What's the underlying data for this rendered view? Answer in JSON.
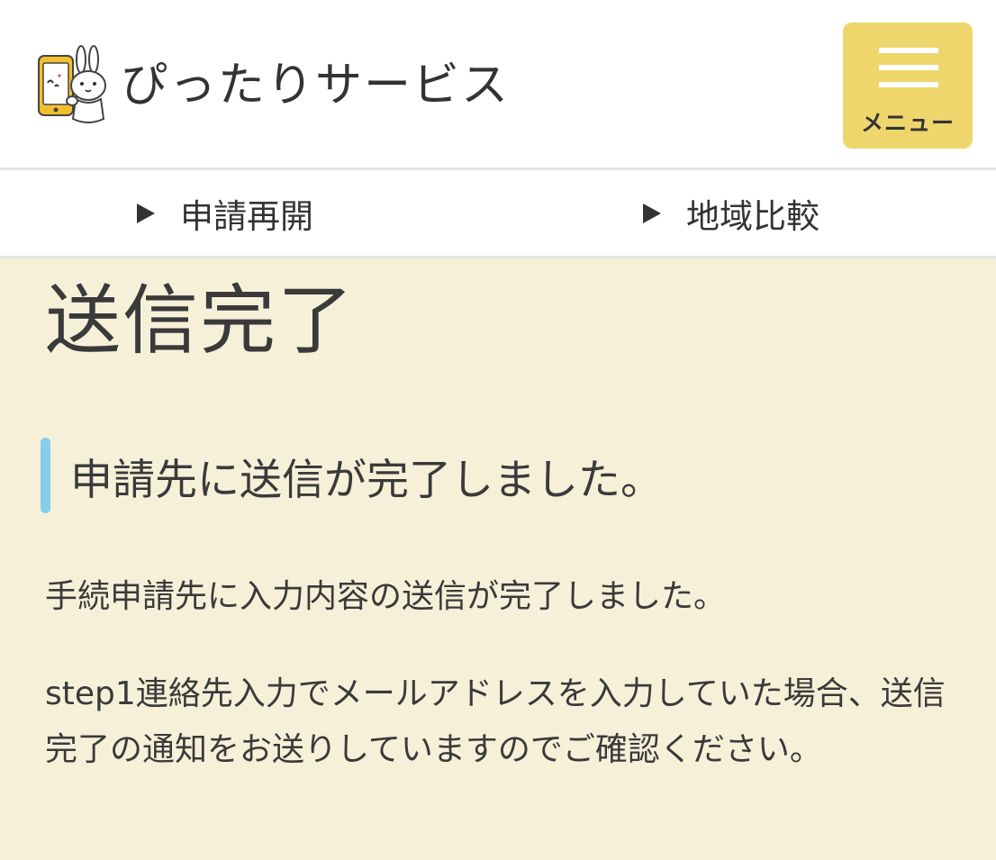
{
  "header": {
    "logo_text": "ぴったりサービス",
    "menu_label": "メニュー"
  },
  "subnav": {
    "links": [
      {
        "label": "申請再開"
      },
      {
        "label": "地域比較"
      }
    ]
  },
  "main": {
    "title": "送信完了",
    "subheading": "申請先に送信が完了しました。",
    "paragraphs": [
      "手続申請先に入力内容の送信が完了しました。",
      "step1連絡先入力でメールアドレスを入力していた場合、送信完了の通知をお送りしていますのでご確認ください。"
    ]
  },
  "colors": {
    "page_background": "#f7f0d9",
    "menu_button": "#efd66c",
    "heading_accent": "#87cdec"
  },
  "icons": {
    "logo": "rabbit-holding-smartphone-icon",
    "menu": "hamburger-menu-icon",
    "subnav_marker": "triangle-right-icon"
  }
}
